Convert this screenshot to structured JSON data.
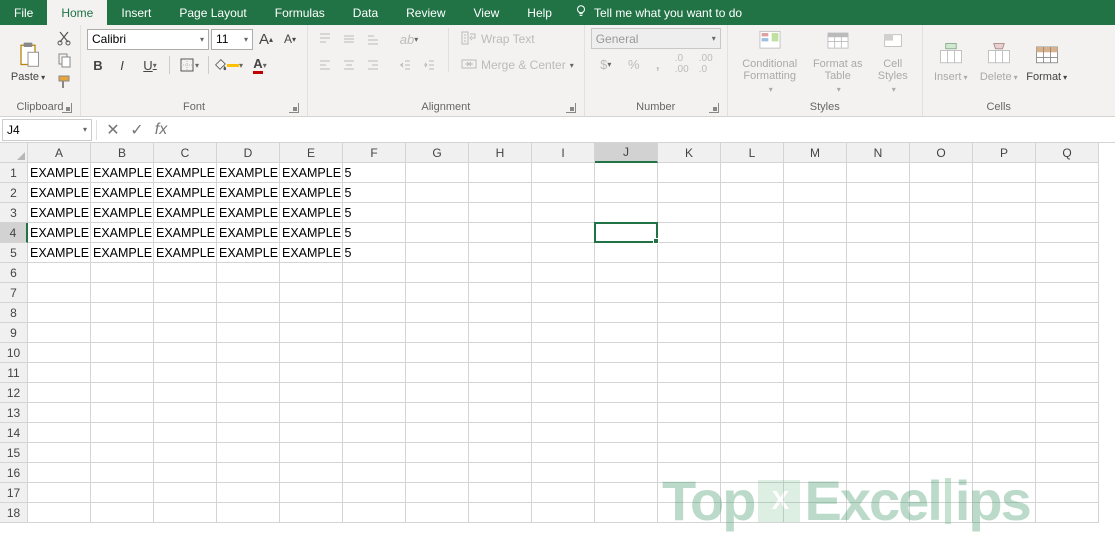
{
  "tabs": [
    "File",
    "Home",
    "Insert",
    "Page Layout",
    "Formulas",
    "Data",
    "Review",
    "View",
    "Help"
  ],
  "active_tab": "Home",
  "tell_me": "Tell me what you want to do",
  "ribbon": {
    "clipboard": {
      "paste": "Paste",
      "label": "Clipboard"
    },
    "font": {
      "name": "Calibri",
      "size": "11",
      "grow": "A",
      "shrink": "A",
      "bold": "B",
      "italic": "I",
      "underline": "U",
      "label": "Font"
    },
    "alignment": {
      "wrap": "Wrap Text",
      "merge": "Merge & Center",
      "label": "Alignment"
    },
    "number": {
      "format": "General",
      "label": "Number"
    },
    "styles": {
      "cond": "Conditional Formatting",
      "table": "Format as Table",
      "cell": "Cell Styles",
      "label": "Styles"
    },
    "cells": {
      "insert": "Insert",
      "delete": "Delete",
      "format": "Format",
      "label": "Cells"
    }
  },
  "name_box": "J4",
  "formula": "",
  "columns": [
    "A",
    "B",
    "C",
    "D",
    "E",
    "F",
    "G",
    "H",
    "I",
    "J",
    "K",
    "L",
    "M",
    "N",
    "O",
    "P",
    "Q"
  ],
  "rows": [
    1,
    2,
    3,
    4,
    5,
    6,
    7,
    8,
    9,
    10,
    11,
    12,
    13,
    14,
    15,
    16,
    17,
    18
  ],
  "data": [
    [
      "EXAMPLE",
      "EXAMPLE",
      "EXAMPLE",
      "EXAMPLE",
      "EXAMPLE 5"
    ],
    [
      "EXAMPLE",
      "EXAMPLE",
      "EXAMPLE",
      "EXAMPLE",
      "EXAMPLE 5"
    ],
    [
      "EXAMPLE",
      "EXAMPLE",
      "EXAMPLE",
      "EXAMPLE",
      "EXAMPLE 5"
    ],
    [
      "EXAMPLE",
      "EXAMPLE",
      "EXAMPLE",
      "EXAMPLE",
      "EXAMPLE 5"
    ],
    [
      "EXAMPLE",
      "EXAMPLE",
      "EXAMPLE",
      "EXAMPLE",
      "EXAMPLE 5"
    ]
  ],
  "active": {
    "col": "J",
    "row": 4
  },
  "watermark": {
    "t1": "Top",
    "t2": "Excel",
    "t3": "ips",
    "x": "X"
  }
}
